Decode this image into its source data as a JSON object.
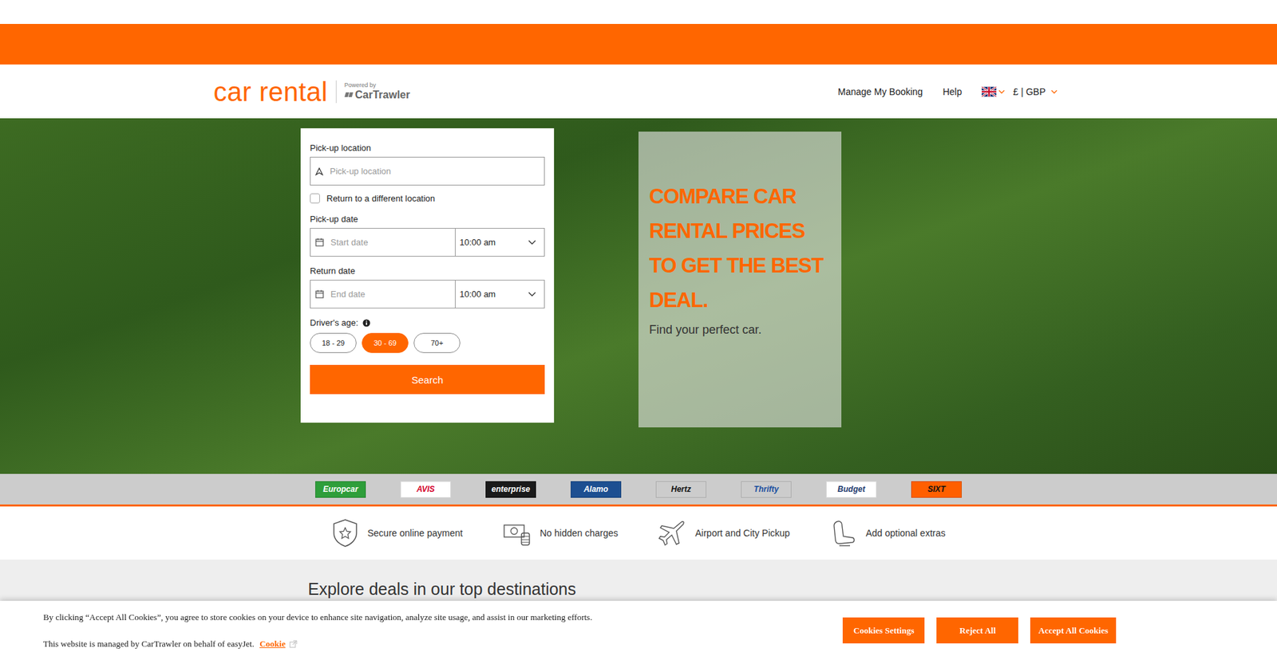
{
  "header": {
    "logo": "car rental",
    "powered_by": "Powered by",
    "brand": "CarTrawler",
    "nav": [
      "Manage My Booking",
      "Help"
    ],
    "currency": "£ | GBP"
  },
  "search_form": {
    "pickup_label": "Pick-up location",
    "pickup_placeholder": "Pick-up location",
    "different_return": {
      "label": "Return to a different location",
      "checked": false
    },
    "pickup_date_label": "Pick-up date",
    "start_placeholder": "Start date",
    "pickup_time": "10:00 am",
    "return_date_label": "Return date",
    "end_placeholder": "End date",
    "return_time": "10:00 am",
    "age_label": "Driver's age:",
    "ages": [
      {
        "label": "18 - 29",
        "selected": false
      },
      {
        "label": "30 - 69",
        "selected": true
      },
      {
        "label": "70+",
        "selected": false
      }
    ],
    "search_button": "Search"
  },
  "promo": {
    "heading": "COMPARE CAR RENTAL PRICES TO GET THE BEST DEAL.",
    "subtitle": "Find your perfect car."
  },
  "brands": [
    {
      "name": "Europcar",
      "color": "#2e9e3a",
      "text_color": "#ffffff"
    },
    {
      "name": "AVIS",
      "color": "#ffffff",
      "text_color": "#d4002a"
    },
    {
      "name": "enterprise",
      "color": "#1a1a1a",
      "text_color": "#ffffff"
    },
    {
      "name": "Alamo",
      "color": "#1d4f91",
      "text_color": "#ffffff"
    },
    {
      "name": "Hertz",
      "color": "#cccccc",
      "text_color": "#111111"
    },
    {
      "name": "Thrifty",
      "color": "#cccccc",
      "text_color": "#1b4fa0"
    },
    {
      "name": "Budget",
      "color": "#ffffff",
      "text_color": "#1e3a6e"
    },
    {
      "name": "SIXT",
      "color": "#ff5f00",
      "text_color": "#111111"
    }
  ],
  "features": [
    {
      "label": "Secure online payment",
      "kind": "shield"
    },
    {
      "label": "No hidden charges",
      "kind": "cash"
    },
    {
      "label": "Airport and City Pickup",
      "kind": "plane"
    },
    {
      "label": "Add optional extras",
      "kind": "seat"
    }
  ],
  "section_title": "Explore deals in our top destinations",
  "cookie_banner": {
    "text": "By clicking “Accept All Cookies”, you agree to store cookies on your device to enhance site navigation, analyze site usage, and assist in our marketing efforts.",
    "managed": "This website is managed by CarTrawler on behalf of easyJet.",
    "link": "Cookie",
    "buttons": [
      "Cookies Settings",
      "Reject All",
      "Accept All Cookies"
    ]
  }
}
